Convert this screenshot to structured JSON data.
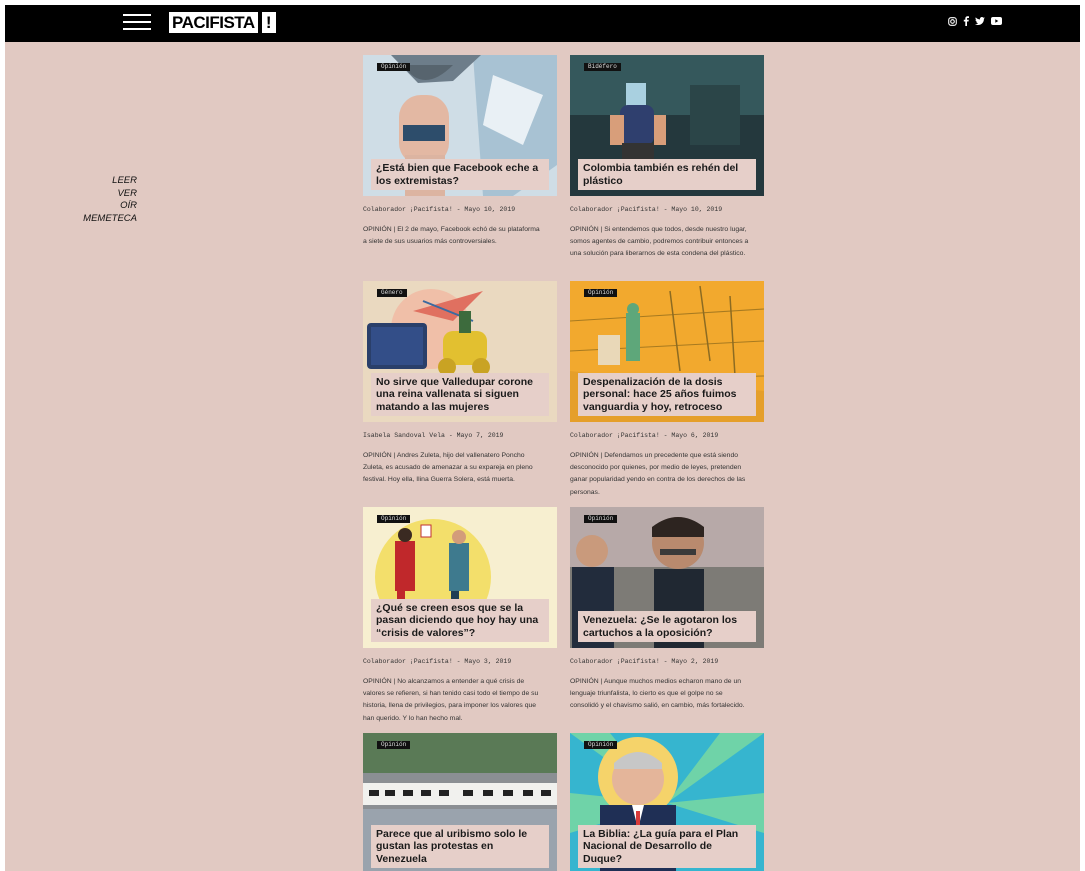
{
  "header": {
    "logo_word": "PACIFISTA",
    "logo_mark": "!",
    "social": [
      "instagram-icon",
      "facebook-icon",
      "twitter-icon",
      "youtube-icon"
    ]
  },
  "sidenav": {
    "items": [
      "LEER",
      "VER",
      "OÍR",
      "MEMETECA"
    ]
  },
  "cards": [
    {
      "category": "Opinión",
      "title": "¿Está bien que Facebook eche a los extremistas?",
      "meta": "Colaborador ¡Pacifista! - Mayo 10, 2019",
      "excerpt": "OPINIÓN | El 2 de mayo, Facebook echó de su plataforma a siete de sus usuarios más controversiales."
    },
    {
      "category": "Bidéfero",
      "title": "Colombia también es rehén del plástico",
      "meta": "Colaborador ¡Pacifista! - Mayo 10, 2019",
      "excerpt": "OPINIÓN | Si entendemos que todos, desde nuestro lugar, somos agentes de cambio, podremos contribuir entonces a una solución para liberarnos de esta condena del plástico."
    },
    {
      "category": "Género",
      "title": "No sirve que Valledupar corone una reina vallenata si siguen matando a las mujeres",
      "meta": "Isabela Sandoval Vela - Mayo 7, 2019",
      "excerpt": "OPINIÓN | Andres Zuleta, hijo del vallenatero Poncho Zuleta, es acusado de amenazar a su expareja en pleno festival. Hoy ella, Ilina Guerra Solera, está muerta."
    },
    {
      "category": "Opinión",
      "title": "Despenalización de la dosis personal: hace 25 años fuimos vanguardia y hoy, retroceso",
      "meta": "Colaborador ¡Pacifista! - Mayo 6, 2019",
      "excerpt": "OPINIÓN | Defendamos un precedente que está siendo desconocido por quienes, por medio de leyes, pretenden ganar popularidad yendo en contra de los derechos de las personas."
    },
    {
      "category": "Opinión",
      "title": "¿Qué se creen esos que se la pasan diciendo que hoy hay una “crisis de valores”?",
      "meta": "Colaborador ¡Pacifista! - Mayo 3, 2019",
      "excerpt": "OPINIÓN | No alcanzamos a entender a qué crisis de valores se refieren, si han tenido casi todo el tiempo de su historia, llena de privilegios, para imponer los valores que han querido. Y lo han hecho mal."
    },
    {
      "category": "Opinión",
      "title": "Venezuela: ¿Se le agotaron los cartuchos a la oposición?",
      "meta": "Colaborador ¡Pacifista! - Mayo 2, 2019",
      "excerpt": "OPINIÓN | Aunque muchos medios echaron mano de un lenguaje triunfalista, lo cierto es que el golpe no se consolidó y el chavismo salió, en cambio, más fortalecido."
    },
    {
      "category": "Opinión",
      "title": "Parece que al uribismo solo le gustan las protestas en Venezuela",
      "meta": "",
      "excerpt": ""
    },
    {
      "category": "Opinión",
      "title": "La Biblia: ¿La guía para el Plan Nacional de Desarrollo de Duque?",
      "meta": "",
      "excerpt": ""
    }
  ]
}
